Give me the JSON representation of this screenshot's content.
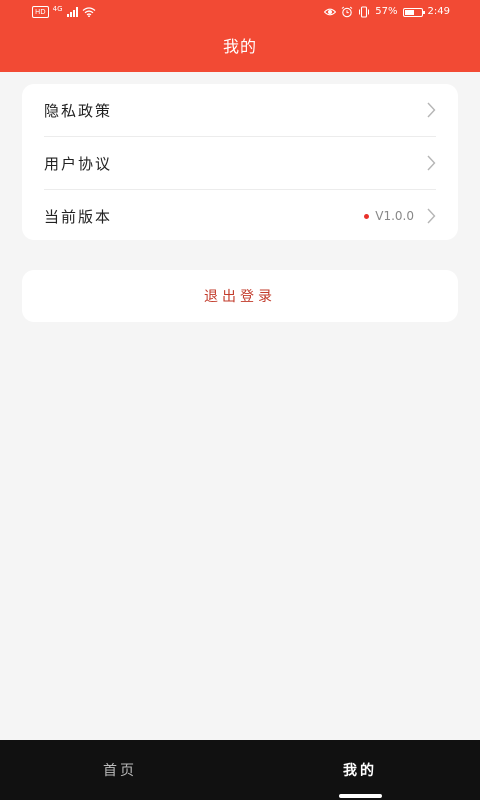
{
  "status_bar": {
    "badge": "HD",
    "network": "4G",
    "battery_text": "57%",
    "battery_level": 0.57,
    "time": "2:49"
  },
  "header": {
    "title": "我的"
  },
  "menu": {
    "items": [
      {
        "label": "隐私政策"
      },
      {
        "label": "用户协议"
      },
      {
        "label": "当前版本",
        "value": "V1.0.0"
      }
    ]
  },
  "logout": {
    "label": "退出登录"
  },
  "tabs": [
    {
      "label": "首页"
    },
    {
      "label": "我的"
    }
  ],
  "colors": {
    "header": "#f24a34",
    "background": "#f5f5f5",
    "logout_text": "#c23b2b",
    "badge_dot": "#e8312a",
    "tabbar": "#111111"
  }
}
